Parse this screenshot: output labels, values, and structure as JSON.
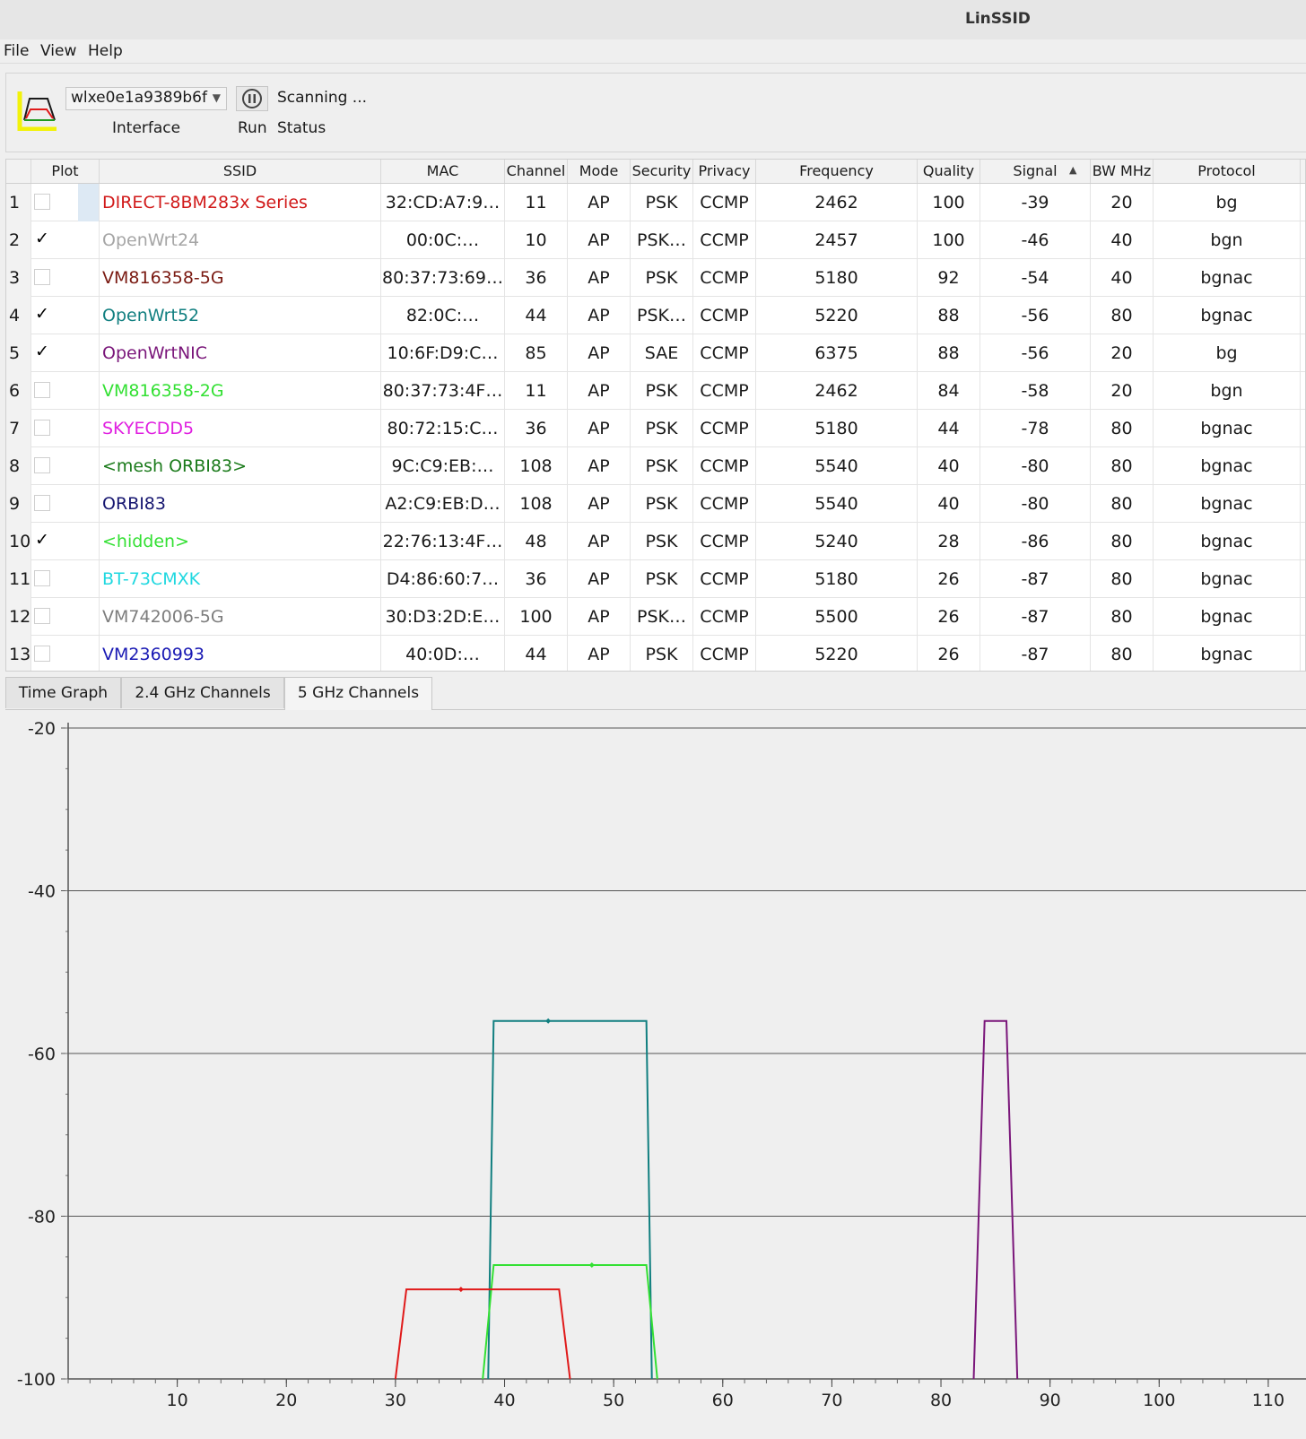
{
  "window": {
    "title": "LinSSID"
  },
  "menu": {
    "file": "File",
    "view": "View",
    "help": "Help"
  },
  "toolbar": {
    "interface_value": "wlxe0e1a9389b6f",
    "interface_label": "Interface",
    "run_label": "Run",
    "status_label": "Status",
    "status_value": "Scanning ..."
  },
  "table": {
    "columns": [
      "Plot",
      "SSID",
      "MAC",
      "Channel",
      "Mode",
      "Security",
      "Privacy",
      "Frequency",
      "Quality",
      "Signal",
      "BW MHz",
      "Protocol"
    ],
    "rows": [
      {
        "num": "1",
        "plot": false,
        "ssid": "DIRECT-8BM283x Series",
        "color": "#d11a1a",
        "mac": "32:CD:A7:9…",
        "channel": "11",
        "mode": "AP",
        "security": "PSK",
        "privacy": "CCMP",
        "frequency": "2462",
        "quality": "100",
        "signal": "-39",
        "bw": "20",
        "protocol": "bg"
      },
      {
        "num": "2",
        "plot": true,
        "ssid": "OpenWrt24",
        "color": "#a6a6a6",
        "mac": "00:0C:…",
        "channel": "10",
        "mode": "AP",
        "security": "PSK…",
        "privacy": "CCMP",
        "frequency": "2457",
        "quality": "100",
        "signal": "-46",
        "bw": "40",
        "protocol": "bgn"
      },
      {
        "num": "3",
        "plot": false,
        "ssid": "VM816358-5G",
        "color": "#7a1a12",
        "mac": "80:37:73:69…",
        "channel": "36",
        "mode": "AP",
        "security": "PSK",
        "privacy": "CCMP",
        "frequency": "5180",
        "quality": "92",
        "signal": "-54",
        "bw": "40",
        "protocol": "bgnac"
      },
      {
        "num": "4",
        "plot": true,
        "ssid": "OpenWrt52",
        "color": "#117f80",
        "mac": "82:0C:…",
        "channel": "44",
        "mode": "AP",
        "security": "PSK…",
        "privacy": "CCMP",
        "frequency": "5220",
        "quality": "88",
        "signal": "-56",
        "bw": "80",
        "protocol": "bgnac"
      },
      {
        "num": "5",
        "plot": true,
        "ssid": "OpenWrtNIC",
        "color": "#7a167a",
        "mac": "10:6F:D9:C…",
        "channel": "85",
        "mode": "AP",
        "security": "SAE",
        "privacy": "CCMP",
        "frequency": "6375",
        "quality": "88",
        "signal": "-56",
        "bw": "20",
        "protocol": "bg"
      },
      {
        "num": "6",
        "plot": false,
        "ssid": "VM816358-2G",
        "color": "#33e033",
        "mac": "80:37:73:4F…",
        "channel": "11",
        "mode": "AP",
        "security": "PSK",
        "privacy": "CCMP",
        "frequency": "2462",
        "quality": "84",
        "signal": "-58",
        "bw": "20",
        "protocol": "bgn"
      },
      {
        "num": "7",
        "plot": false,
        "ssid": "SKYECDD5",
        "color": "#e020e0",
        "mac": "80:72:15:C…",
        "channel": "36",
        "mode": "AP",
        "security": "PSK",
        "privacy": "CCMP",
        "frequency": "5180",
        "quality": "44",
        "signal": "-78",
        "bw": "80",
        "protocol": "bgnac"
      },
      {
        "num": "8",
        "plot": false,
        "ssid": "<mesh ORBI83>",
        "color": "#1a7a1a",
        "mac": "9C:C9:EB:…",
        "channel": "108",
        "mode": "AP",
        "security": "PSK",
        "privacy": "CCMP",
        "frequency": "5540",
        "quality": "40",
        "signal": "-80",
        "bw": "80",
        "protocol": "bgnac"
      },
      {
        "num": "9",
        "plot": false,
        "ssid": "ORBI83",
        "color": "#161670",
        "mac": "A2:C9:EB:D…",
        "channel": "108",
        "mode": "AP",
        "security": "PSK",
        "privacy": "CCMP",
        "frequency": "5540",
        "quality": "40",
        "signal": "-80",
        "bw": "80",
        "protocol": "bgnac"
      },
      {
        "num": "10",
        "plot": true,
        "ssid": "<hidden>",
        "color": "#33e033",
        "mac": "22:76:13:4F…",
        "channel": "48",
        "mode": "AP",
        "security": "PSK",
        "privacy": "CCMP",
        "frequency": "5240",
        "quality": "28",
        "signal": "-86",
        "bw": "80",
        "protocol": "bgnac"
      },
      {
        "num": "11",
        "plot": false,
        "ssid": "BT-73CMXK",
        "color": "#20d8e0",
        "mac": "D4:86:60:7…",
        "channel": "36",
        "mode": "AP",
        "security": "PSK",
        "privacy": "CCMP",
        "frequency": "5180",
        "quality": "26",
        "signal": "-87",
        "bw": "80",
        "protocol": "bgnac"
      },
      {
        "num": "12",
        "plot": false,
        "ssid": "VM742006-5G",
        "color": "#7d7d7d",
        "mac": "30:D3:2D:E…",
        "channel": "100",
        "mode": "AP",
        "security": "PSK…",
        "privacy": "CCMP",
        "frequency": "5500",
        "quality": "26",
        "signal": "-87",
        "bw": "80",
        "protocol": "bgnac"
      },
      {
        "num": "13",
        "plot": false,
        "ssid": "VM2360993",
        "color": "#1a1ab4",
        "mac": "40:0D:…",
        "channel": "44",
        "mode": "AP",
        "security": "PSK",
        "privacy": "CCMP",
        "frequency": "5220",
        "quality": "26",
        "signal": "-87",
        "bw": "80",
        "protocol": "bgnac"
      }
    ]
  },
  "tabs": [
    {
      "label": "Time Graph",
      "active": false
    },
    {
      "label": "2.4 GHz Channels",
      "active": false
    },
    {
      "label": "5 GHz Channels",
      "active": true
    }
  ],
  "chart_data": {
    "type": "line",
    "x_ticks": [
      10,
      20,
      30,
      40,
      50,
      60,
      70,
      80,
      90,
      100,
      110
    ],
    "y_ticks": [
      -20,
      -40,
      -60,
      -80,
      -100
    ],
    "xlim": [
      0,
      110.5
    ],
    "ylim": [
      -100,
      -20
    ],
    "grid": "horizontal",
    "series": [
      {
        "color": "#117f80",
        "x": [
          38.5,
          39,
          53,
          53.5
        ],
        "y": [
          -100,
          -56,
          -56,
          -100
        ],
        "marker": {
          "x": 44,
          "y": -56
        }
      },
      {
        "color": "#7a167a",
        "x": [
          83,
          84,
          86,
          87
        ],
        "y": [
          -100,
          -56,
          -56,
          -100
        ],
        "marker": null
      },
      {
        "color": "#33e033",
        "x": [
          38,
          39,
          53,
          54
        ],
        "y": [
          -100,
          -86,
          -86,
          -100
        ],
        "marker": {
          "x": 48,
          "y": -86
        }
      },
      {
        "color": "#e01a1a",
        "x": [
          30,
          31,
          45,
          46
        ],
        "y": [
          -100,
          -89,
          -89,
          -100
        ],
        "marker": {
          "x": 36,
          "y": -89
        }
      }
    ]
  }
}
